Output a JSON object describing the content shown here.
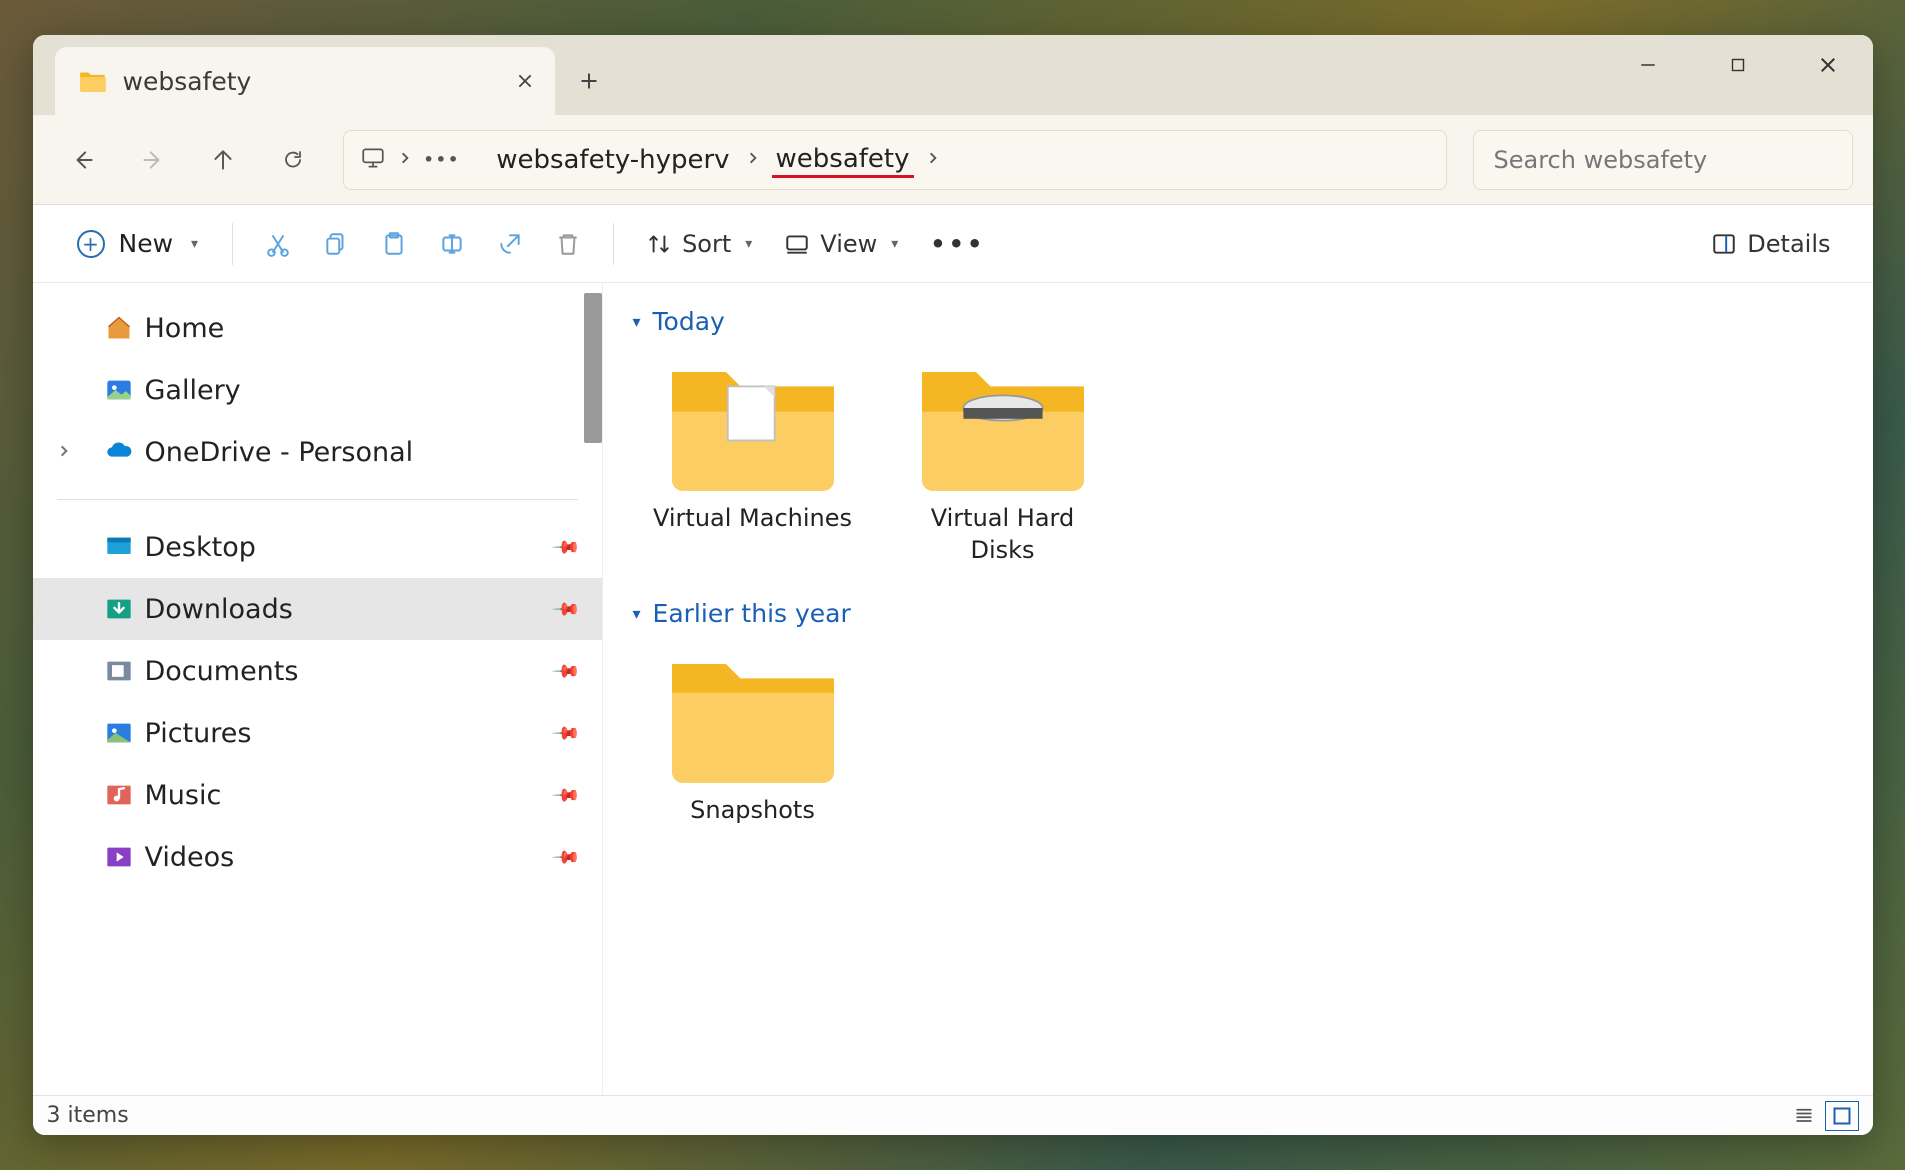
{
  "window": {
    "tab_title": "websafety"
  },
  "breadcrumb": {
    "segments": [
      "websafety-hyperv",
      "websafety"
    ],
    "current_index": 1
  },
  "search": {
    "placeholder": "Search websafety"
  },
  "toolbar": {
    "new_label": "New",
    "sort_label": "Sort",
    "view_label": "View",
    "details_label": "Details"
  },
  "sidebar": {
    "items": [
      {
        "label": "Home",
        "icon": "home"
      },
      {
        "label": "Gallery",
        "icon": "gallery"
      },
      {
        "label": "OneDrive - Personal",
        "icon": "onedrive",
        "expandable": true
      }
    ],
    "pinned": [
      {
        "label": "Desktop",
        "icon": "desktop"
      },
      {
        "label": "Downloads",
        "icon": "downloads",
        "selected": true
      },
      {
        "label": "Documents",
        "icon": "documents"
      },
      {
        "label": "Pictures",
        "icon": "pictures"
      },
      {
        "label": "Music",
        "icon": "music"
      },
      {
        "label": "Videos",
        "icon": "videos"
      }
    ]
  },
  "groups": [
    {
      "name": "Today",
      "items": [
        {
          "label": "Virtual Machines",
          "type": "folder-doc"
        },
        {
          "label": "Virtual Hard Disks",
          "type": "folder-disk"
        }
      ]
    },
    {
      "name": "Earlier this year",
      "items": [
        {
          "label": "Snapshots",
          "type": "folder-plain"
        }
      ]
    }
  ],
  "status": {
    "text": "3 items"
  }
}
